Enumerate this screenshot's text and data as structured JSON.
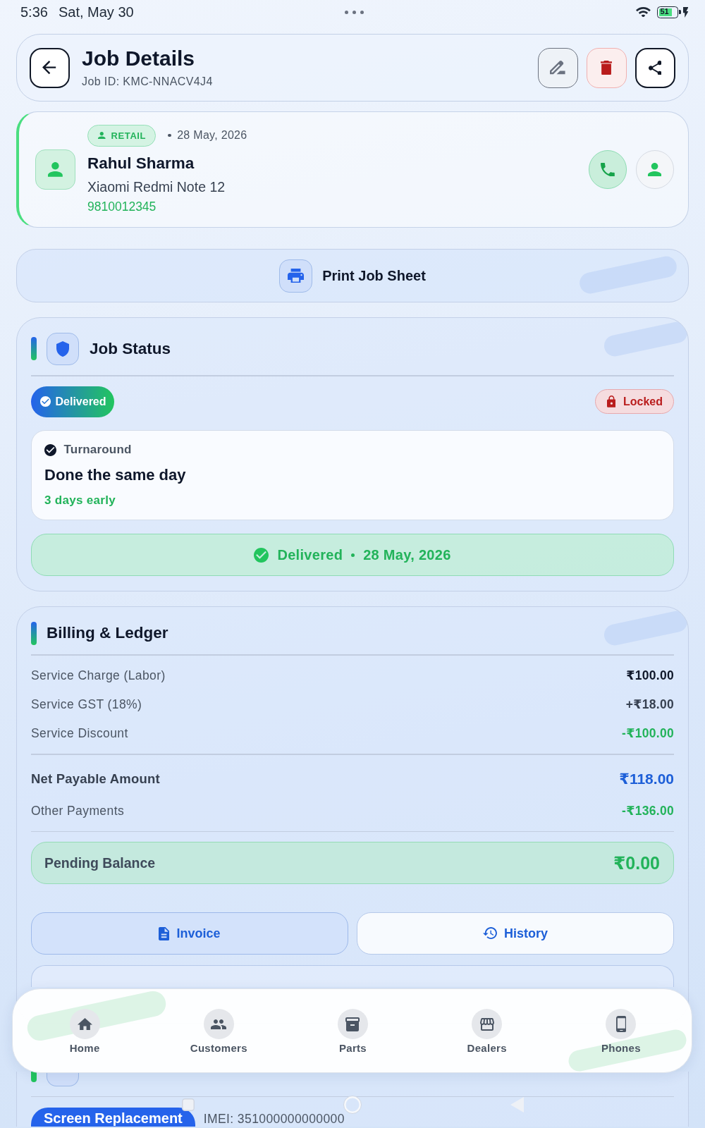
{
  "status_bar": {
    "time": "5:36",
    "date": "Sat, May 30",
    "battery": "51"
  },
  "header": {
    "title": "Job Details",
    "job_id": "Job ID: KMC-NNACV4J4"
  },
  "customer": {
    "badge": "RETAIL",
    "date": "28 May, 2026",
    "name": "Rahul Sharma",
    "device": "Xiaomi Redmi Note 12",
    "phone": "9810012345"
  },
  "print_button": {
    "label": "Print Job Sheet"
  },
  "job_status": {
    "title": "Job Status",
    "status": "Delivered",
    "lock": "Locked",
    "turnaround": {
      "label": "Turnaround",
      "value": "Done the same day",
      "note": "3 days early"
    },
    "delivered_banner": {
      "status": "Delivered",
      "date": "28 May, 2026"
    }
  },
  "billing": {
    "title": "Billing & Ledger",
    "lines": [
      {
        "label": "Service Charge (Labor)",
        "amount": "₹100.00",
        "kind": "charge"
      },
      {
        "label": "Service GST (18%)",
        "amount": "+₹18.00",
        "kind": "tax"
      },
      {
        "label": "Service Discount",
        "amount": "-₹100.00",
        "kind": "credit"
      }
    ],
    "net": {
      "label": "Net Payable Amount",
      "amount": "₹118.00"
    },
    "payments": [
      {
        "label": "Other Payments",
        "amount": "-₹136.00",
        "kind": "credit"
      }
    ],
    "pending": {
      "label": "Pending Balance",
      "amount": "₹0.00"
    },
    "actions": [
      {
        "label": "Invoice",
        "kind": "primary"
      },
      {
        "label": "History",
        "kind": "secondary"
      }
    ]
  },
  "device_issue": {
    "issue": "Screen Replacement",
    "imei": "IMEI: 351000000000000"
  },
  "bottom_nav": [
    {
      "label": "Home",
      "selected": false
    },
    {
      "label": "Customers",
      "selected": false
    },
    {
      "label": "Parts",
      "selected": false
    },
    {
      "label": "Dealers",
      "selected": false
    },
    {
      "label": "Phones",
      "selected": false
    }
  ]
}
